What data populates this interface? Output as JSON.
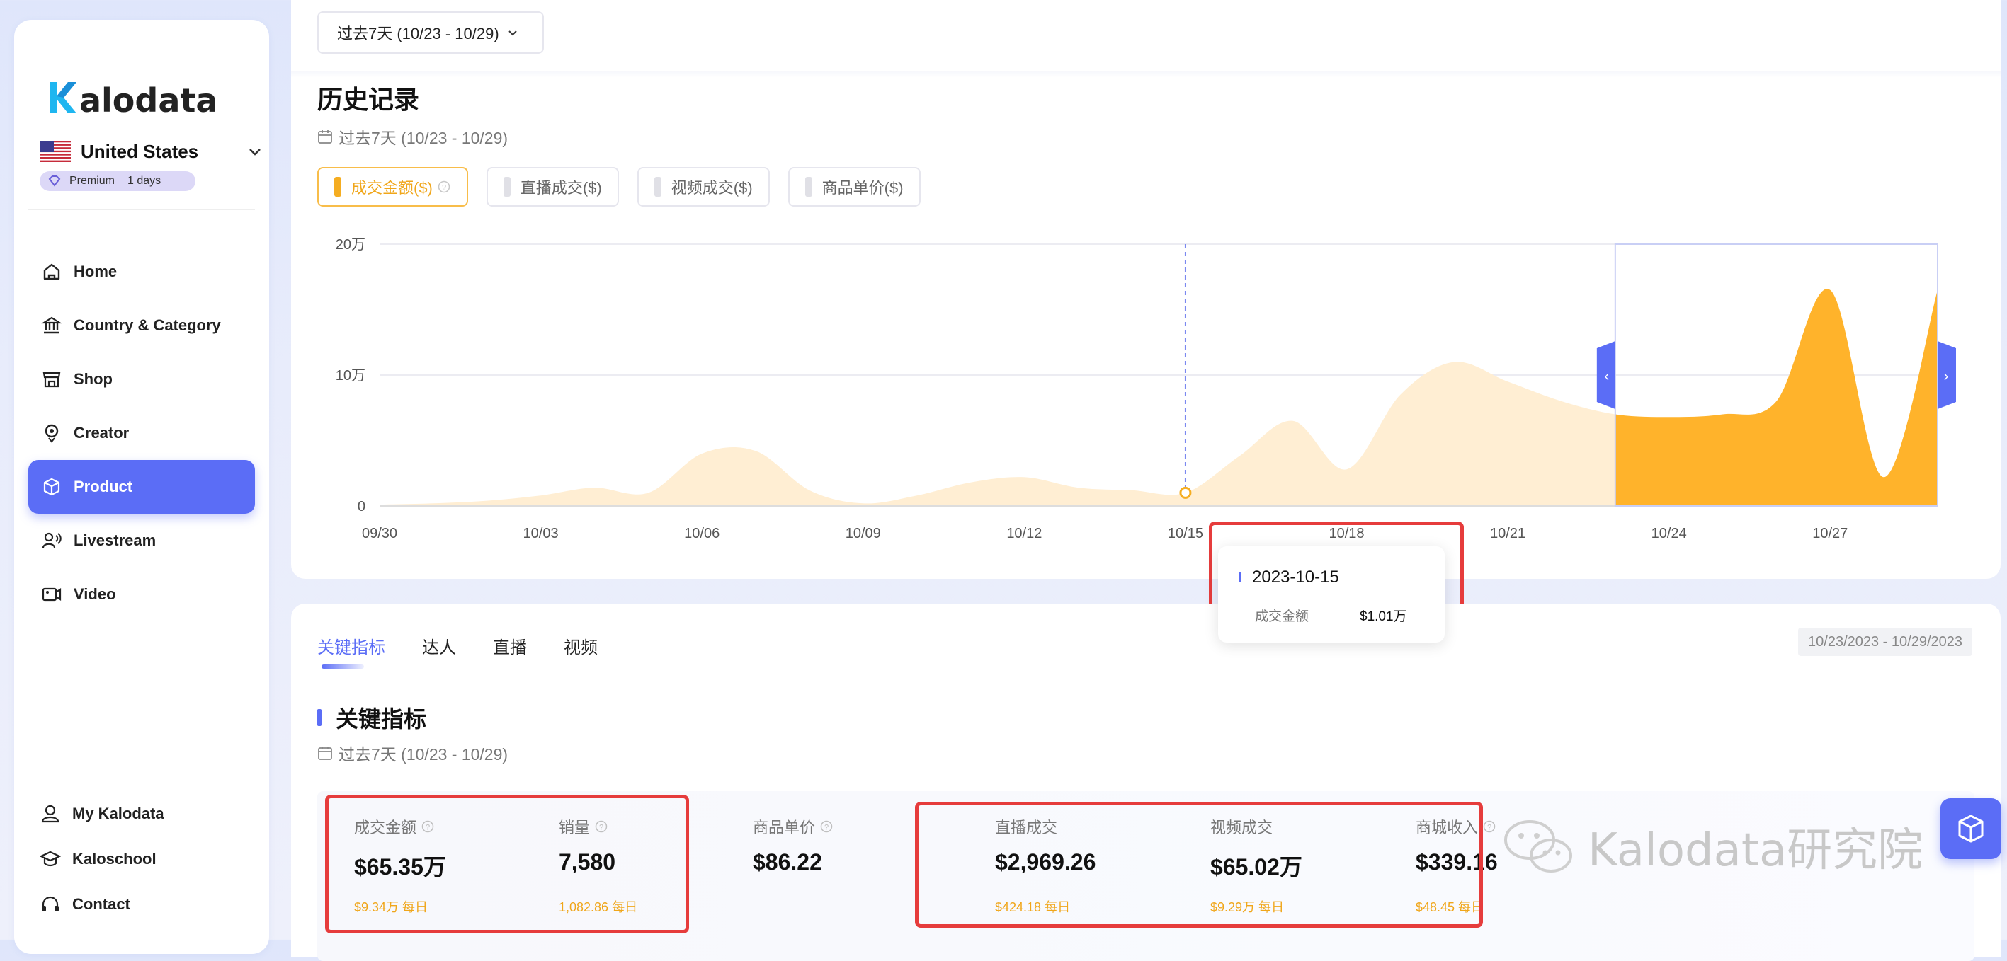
{
  "sidebar": {
    "logo_text": "Kalodata",
    "country": "United States",
    "premium_label": "Premium",
    "premium_days": "1 days",
    "nav": [
      {
        "label": "Home",
        "icon": "home-icon"
      },
      {
        "label": "Country & Category",
        "icon": "bank-icon"
      },
      {
        "label": "Shop",
        "icon": "shop-icon"
      },
      {
        "label": "Creator",
        "icon": "creator-icon"
      },
      {
        "label": "Product",
        "icon": "product-box-icon",
        "active": true
      },
      {
        "label": "Livestream",
        "icon": "livestream-icon"
      },
      {
        "label": "Video",
        "icon": "video-icon"
      }
    ],
    "bottom_nav": [
      {
        "label": "My Kalodata",
        "icon": "user-icon"
      },
      {
        "label": "Kaloschool",
        "icon": "graduation-cap-icon"
      },
      {
        "label": "Contact",
        "icon": "headphones-icon"
      }
    ]
  },
  "top": {
    "range_selector": "过去7天 (10/23 - 10/29)",
    "history_title": "历史记录",
    "history_date": "过去7天 (10/23 - 10/29)",
    "metric_tabs": [
      {
        "label": "成交金额($)",
        "active": true,
        "has_help": true
      },
      {
        "label": "直播成交($)",
        "active": false
      },
      {
        "label": "视频成交($)",
        "active": false
      },
      {
        "label": "商品单价($)",
        "active": false
      }
    ]
  },
  "chart_data": {
    "type": "area",
    "series_name": "成交金额",
    "y_ticks": [
      "20万",
      "10万",
      "0"
    ],
    "ylim": [
      0,
      200000
    ],
    "x_tick_labels": [
      "09/30",
      "10/03",
      "10/06",
      "10/09",
      "10/12",
      "10/15",
      "10/18",
      "10/21",
      "10/24",
      "10/27"
    ],
    "x": [
      "09/30",
      "10/01",
      "10/02",
      "10/03",
      "10/04",
      "10/05",
      "10/06",
      "10/07",
      "10/08",
      "10/09",
      "10/10",
      "10/11",
      "10/12",
      "10/13",
      "10/14",
      "10/15",
      "10/16",
      "10/17",
      "10/18",
      "10/19",
      "10/20",
      "10/21",
      "10/22",
      "10/23",
      "10/24",
      "10/25",
      "10/26",
      "10/27",
      "10/28",
      "10/29"
    ],
    "values": [
      1000,
      2000,
      4000,
      8000,
      14000,
      10000,
      40000,
      42000,
      12000,
      2000,
      8000,
      18000,
      22000,
      14000,
      12000,
      10100,
      38000,
      65000,
      28000,
      85000,
      110000,
      95000,
      80000,
      70000,
      68000,
      70000,
      80000,
      165000,
      22000,
      165000
    ],
    "highlight_range": [
      "10/23",
      "10/29"
    ],
    "selected_point": {
      "date": "2023-10-15",
      "label": "成交金额",
      "value": "$1.01万"
    },
    "colors": {
      "selected_fill": "#FFB32B",
      "other_fill": "#FFEED3",
      "brush": "#5B6DF6"
    }
  },
  "bottom": {
    "tabs": [
      "关键指标",
      "达人",
      "直播",
      "视频"
    ],
    "active_tab": "关键指标",
    "date_range": "10/23/2023 - 10/29/2023",
    "kpi_title": "关键指标",
    "kpi_date": "过去7天 (10/23 - 10/29)",
    "kpis": [
      {
        "label": "成交金额",
        "value": "$65.35万",
        "daily": "$9.34万 每日",
        "help": true
      },
      {
        "label": "销量",
        "value": "7,580",
        "daily": "1,082.86 每日",
        "help": true
      },
      {
        "label": "商品单价",
        "value": "$86.22",
        "daily": "",
        "help": true
      },
      {
        "label": "直播成交",
        "value": "$2,969.26",
        "daily": "$424.18 每日",
        "help": false
      },
      {
        "label": "视频成交",
        "value": "$65.02万",
        "daily": "$9.29万 每日",
        "help": false
      },
      {
        "label": "商城收入",
        "value": "$339.16",
        "daily": "$48.45 每日",
        "help": true
      }
    ]
  },
  "watermark": "Kalodata研究院",
  "colors": {
    "accent": "#5B6DF6",
    "highlight": "#E63C3C",
    "orange": "#F0A61A"
  }
}
